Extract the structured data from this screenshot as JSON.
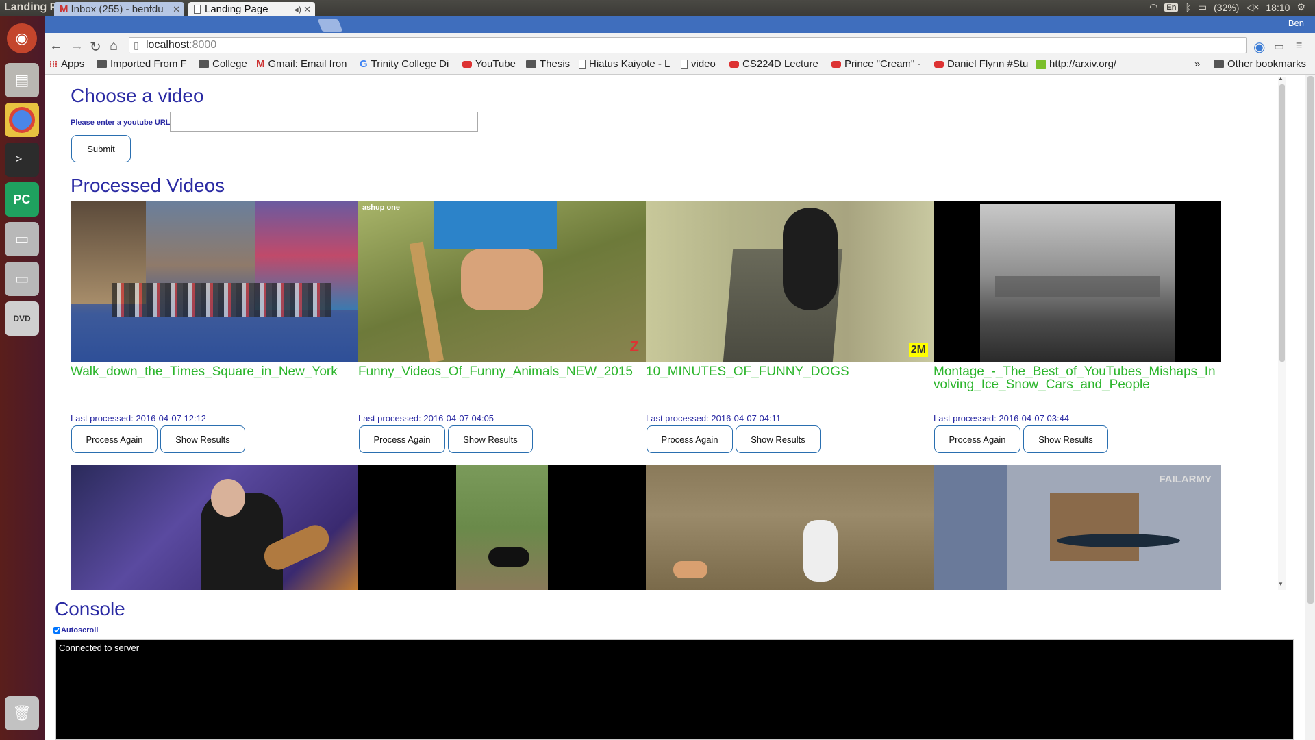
{
  "system": {
    "window_title": "Landing Page - Google Chrome",
    "keyboard": "En",
    "battery": "(32%)",
    "clock": "18:10"
  },
  "browser": {
    "tabs": [
      {
        "label": "Inbox (255) - benfdu",
        "active": false
      },
      {
        "label": "Landing Page",
        "active": true
      }
    ],
    "profile": "Ben",
    "url_host": "localhost",
    "url_port": ":8000",
    "bookmarks": [
      {
        "label": "Apps",
        "icon": "apps-icon"
      },
      {
        "label": "Imported From F",
        "icon": "folder-icon"
      },
      {
        "label": "College",
        "icon": "folder-icon"
      },
      {
        "label": "Gmail: Email fron",
        "icon": "gmail-icon"
      },
      {
        "label": "Trinity College Di",
        "icon": "google-icon"
      },
      {
        "label": "YouTube",
        "icon": "youtube-icon"
      },
      {
        "label": "Thesis",
        "icon": "folder-icon"
      },
      {
        "label": "Hiatus Kaiyote - L",
        "icon": "page-icon"
      },
      {
        "label": "video",
        "icon": "page-icon"
      },
      {
        "label": "CS224D Lecture",
        "icon": "youtube-icon"
      },
      {
        "label": "Prince \"Cream\" -",
        "icon": "youtube-icon"
      },
      {
        "label": "Daniel Flynn #Stu",
        "icon": "youtube-icon"
      },
      {
        "label": "http://arxiv.org/",
        "icon": "arxiv-icon"
      }
    ],
    "other_bookmarks": "Other bookmarks",
    "overflow": "»"
  },
  "page": {
    "choose_heading": "Choose a video",
    "url_label": "Please enter a youtube URL:",
    "url_value": "",
    "submit_label": "Submit",
    "processed_heading": "Processed Videos",
    "videos": [
      {
        "title": "Walk_down_the_Times_Square_in_New_York",
        "date": "Last processed: 2016-04-07 12:12"
      },
      {
        "title": "Funny_Videos_Of_Funny_Animals_NEW_2015",
        "date": "Last processed: 2016-04-07 04:05"
      },
      {
        "title": "10_MINUTES_OF_FUNNY_DOGS",
        "date": "Last processed: 2016-04-07 04:11"
      },
      {
        "title": "Montage_-_The_Best_of_YouTubes_Mishaps_Involving_Ice_Snow_Cars_and_People",
        "date": "Last processed: 2016-04-07 03:44"
      }
    ],
    "process_again_label": "Process Again",
    "show_results_label": "Show Results",
    "thumb_overlays": {
      "v2": "ashup one",
      "v4": "2M",
      "v8": "FAILARMY"
    },
    "console_heading": "Console",
    "autoscroll_label": "Autoscroll",
    "autoscroll_checked": true,
    "console_text": "Connected to server"
  },
  "colors": {
    "heading": "#2a2aa3",
    "video_title": "#2cb52c",
    "button_border": "#2a6fb0",
    "tabstrip": "#3f6ebd"
  }
}
